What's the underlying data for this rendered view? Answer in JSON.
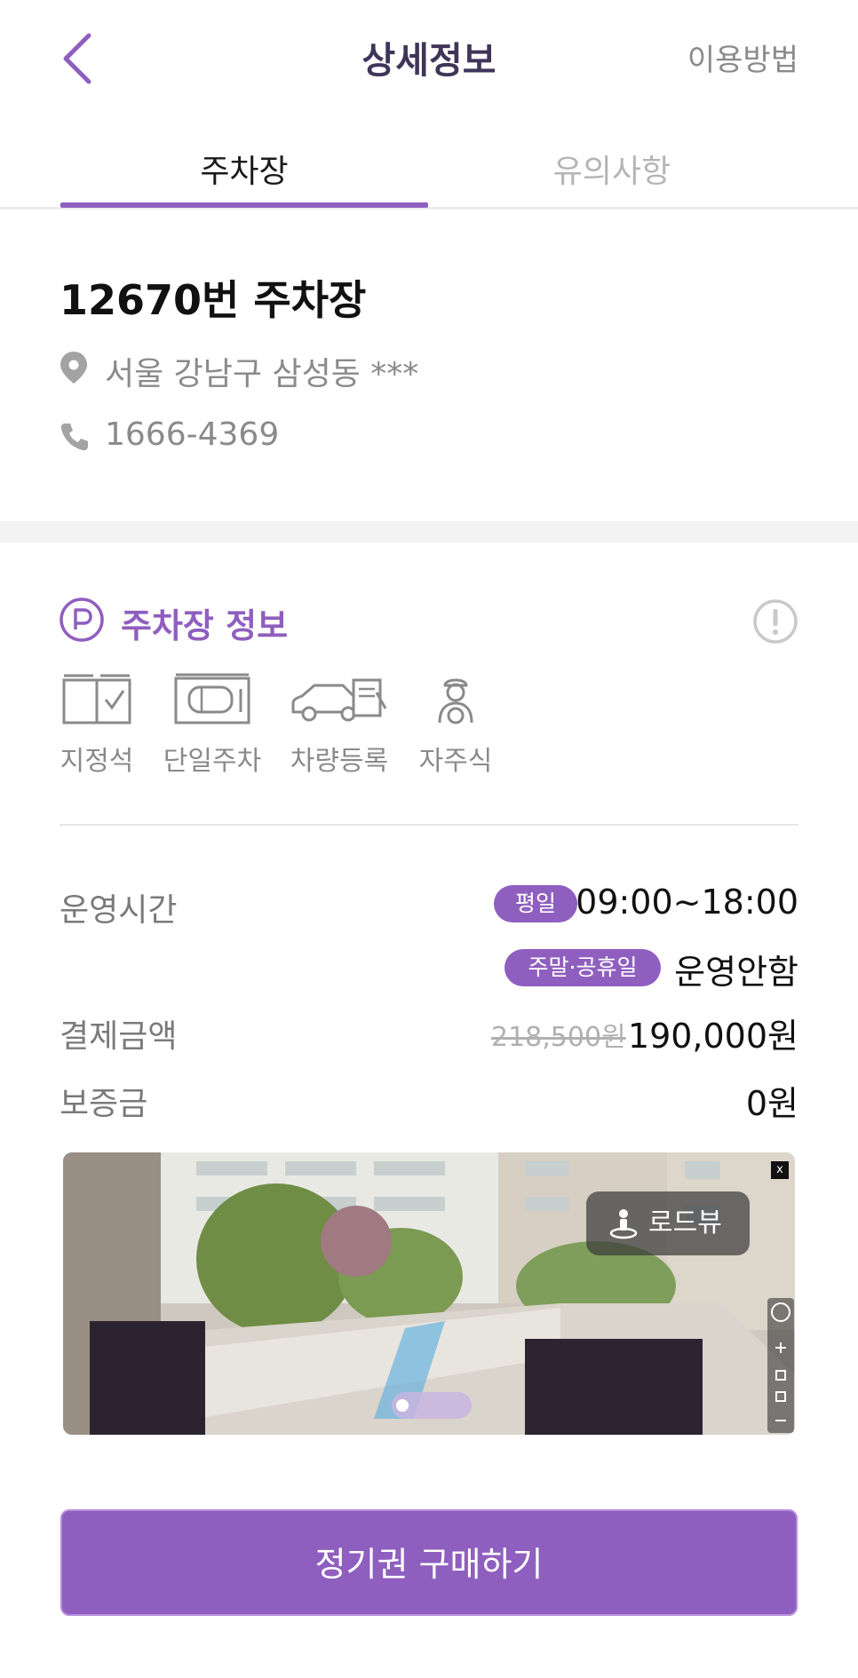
{
  "header": {
    "title": "상세정보",
    "help_label": "이용방법"
  },
  "tabs": [
    {
      "label": "주차장",
      "active": true
    },
    {
      "label": "유의사항",
      "active": false
    }
  ],
  "lot": {
    "name": "12670번 주차장",
    "address": "서울 강남구 삼성동 ***",
    "phone": "1666-4369"
  },
  "info_section": {
    "title": "주차장 정보",
    "features": [
      {
        "icon": "reserved-seat-icon",
        "label": "지정석"
      },
      {
        "icon": "single-parking-icon",
        "label": "단일주차"
      },
      {
        "icon": "vehicle-registration-icon",
        "label": "차량등록"
      },
      {
        "icon": "self-parking-icon",
        "label": "자주식"
      }
    ]
  },
  "details": {
    "hours_label": "운영시간",
    "weekday_badge": "평일",
    "weekday_hours": "09:00~18:00",
    "weekend_badge": "주말·공휴일",
    "weekend_hours": "운영안함",
    "price_label": "결제금액",
    "original_price": "218,500원",
    "price": "190,000원",
    "deposit_label": "보증금",
    "deposit": "0원"
  },
  "roadview": {
    "label": "로드뷰",
    "close_label": "x"
  },
  "cta": {
    "label": "정기권 구매하기"
  },
  "colors": {
    "accent": "#8f5fbf",
    "muted_text": "#8a8a8a",
    "header_title": "#3f3559"
  }
}
